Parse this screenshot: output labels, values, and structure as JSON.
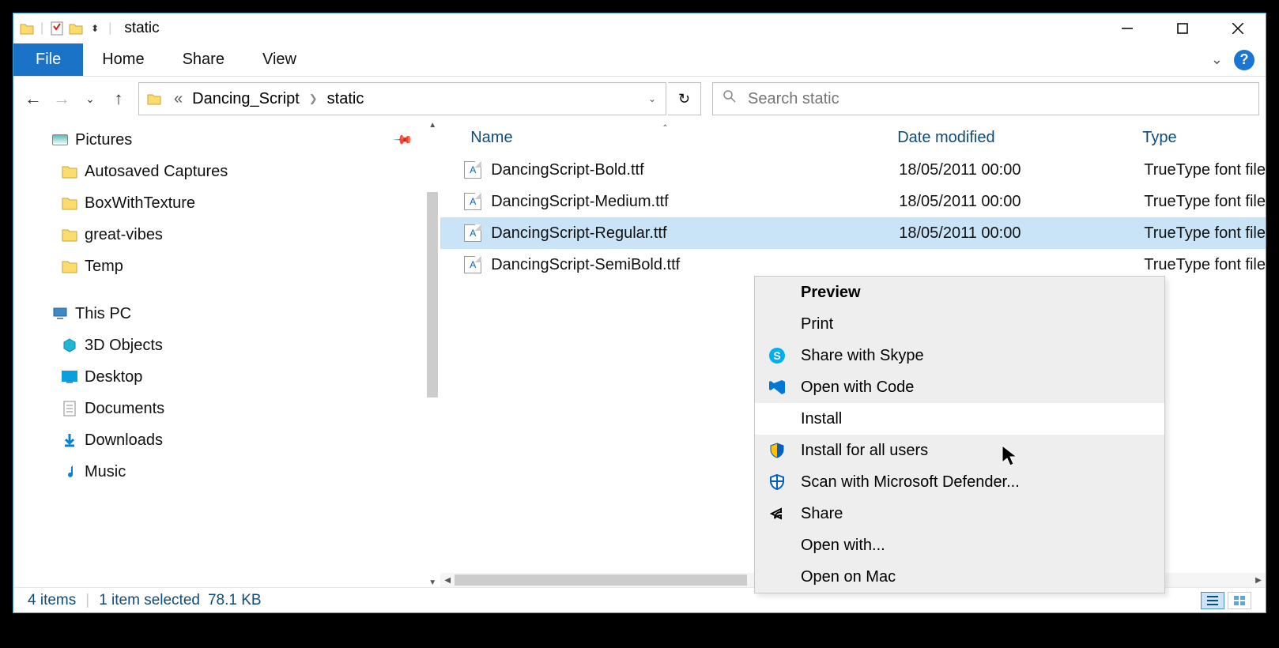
{
  "titlebar": {
    "title": "static"
  },
  "ribbon": {
    "file": "File",
    "tabs": [
      "Home",
      "Share",
      "View"
    ]
  },
  "nav": {
    "crumbPrefix": "«",
    "crumb1": "Dancing_Script",
    "crumb2": "static"
  },
  "search": {
    "placeholder": "Search static"
  },
  "sidebar": {
    "items": [
      {
        "label": "Pictures",
        "icon": "pic",
        "root": true,
        "pin": true
      },
      {
        "label": "Autosaved Captures",
        "icon": "folder"
      },
      {
        "label": "BoxWithTexture",
        "icon": "folder"
      },
      {
        "label": "great-vibes",
        "icon": "folder"
      },
      {
        "label": "Temp",
        "icon": "folder"
      }
    ],
    "pc": [
      {
        "label": "This PC",
        "icon": "pc",
        "root": true
      },
      {
        "label": "3D Objects",
        "icon": "3d"
      },
      {
        "label": "Desktop",
        "icon": "desk"
      },
      {
        "label": "Documents",
        "icon": "doc"
      },
      {
        "label": "Downloads",
        "icon": "dl"
      },
      {
        "label": "Music",
        "icon": "mus"
      }
    ]
  },
  "columns": {
    "name": "Name",
    "date": "Date modified",
    "type": "Type"
  },
  "files": [
    {
      "name": "DancingScript-Bold.ttf",
      "date": "18/05/2011 00:00",
      "type": "TrueType font file",
      "selected": false
    },
    {
      "name": "DancingScript-Medium.ttf",
      "date": "18/05/2011 00:00",
      "type": "TrueType font file",
      "selected": false
    },
    {
      "name": "DancingScript-Regular.ttf",
      "date": "18/05/2011 00:00",
      "type": "TrueType font file",
      "selected": true
    },
    {
      "name": "DancingScript-SemiBold.ttf",
      "date": "",
      "type": "TrueType font file",
      "selected": false
    }
  ],
  "ctx": {
    "items": [
      {
        "label": "Preview",
        "bold": true,
        "icon": ""
      },
      {
        "label": "Print",
        "icon": ""
      },
      {
        "label": "Share with Skype",
        "icon": "skype"
      },
      {
        "label": "Open with Code",
        "icon": "vscode"
      },
      {
        "label": "Install",
        "icon": "",
        "hover": true
      },
      {
        "label": "Install for all users",
        "icon": "shield"
      },
      {
        "label": "Scan with Microsoft Defender...",
        "icon": "defender"
      },
      {
        "label": "Share",
        "icon": "share"
      },
      {
        "label": "Open with...",
        "icon": ""
      },
      {
        "label": "Open on Mac",
        "icon": ""
      }
    ]
  },
  "status": {
    "count": "4 items",
    "selected": "1 item selected",
    "size": "78.1 KB"
  }
}
